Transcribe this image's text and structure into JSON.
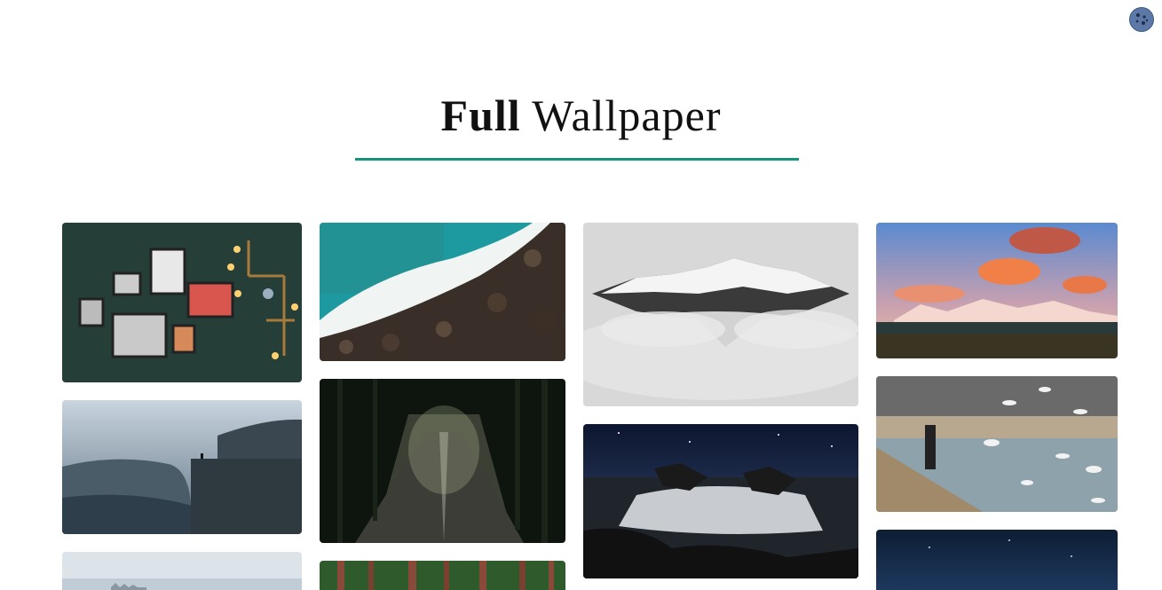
{
  "header": {
    "title_bold": "Full",
    "title_rest": " Wallpaper",
    "accent_color": "#14987a"
  },
  "corner_button": {
    "icon": "cookie-icon"
  },
  "gallery": {
    "columns": [
      [
        {
          "subject": "wall-frames",
          "colors": [
            "#1f3a33",
            "#2e4a42"
          ]
        },
        {
          "subject": "cliff-fjord",
          "colors": [
            "#c6d2dc",
            "#3c4b57"
          ]
        },
        {
          "subject": "foggy-sky",
          "colors": [
            "#dfe6ec",
            "#b6c4cf"
          ]
        }
      ],
      [
        {
          "subject": "ocean-rocks",
          "colors": [
            "#1f9aa0",
            "#2b2620"
          ]
        },
        {
          "subject": "forest-road",
          "colors": [
            "#0c140c",
            "#3a3a32"
          ]
        },
        {
          "subject": "pine-forest",
          "colors": [
            "#2f5a2c",
            "#8a4a3a"
          ]
        }
      ],
      [
        {
          "subject": "snowy-mountain",
          "colors": [
            "#dcdcdc",
            "#3a3a3a"
          ]
        },
        {
          "subject": "night-waterfall",
          "colors": [
            "#0f1a2e",
            "#1a1a1a"
          ]
        }
      ],
      [
        {
          "subject": "sunset-mountains",
          "colors": [
            "#5f8fcf",
            "#f08060"
          ]
        },
        {
          "subject": "seagulls-harbor",
          "colors": [
            "#7a7a7a",
            "#9aa8b0"
          ]
        },
        {
          "subject": "night-sky",
          "colors": [
            "#0f2238",
            "#1b3556"
          ]
        }
      ]
    ]
  }
}
